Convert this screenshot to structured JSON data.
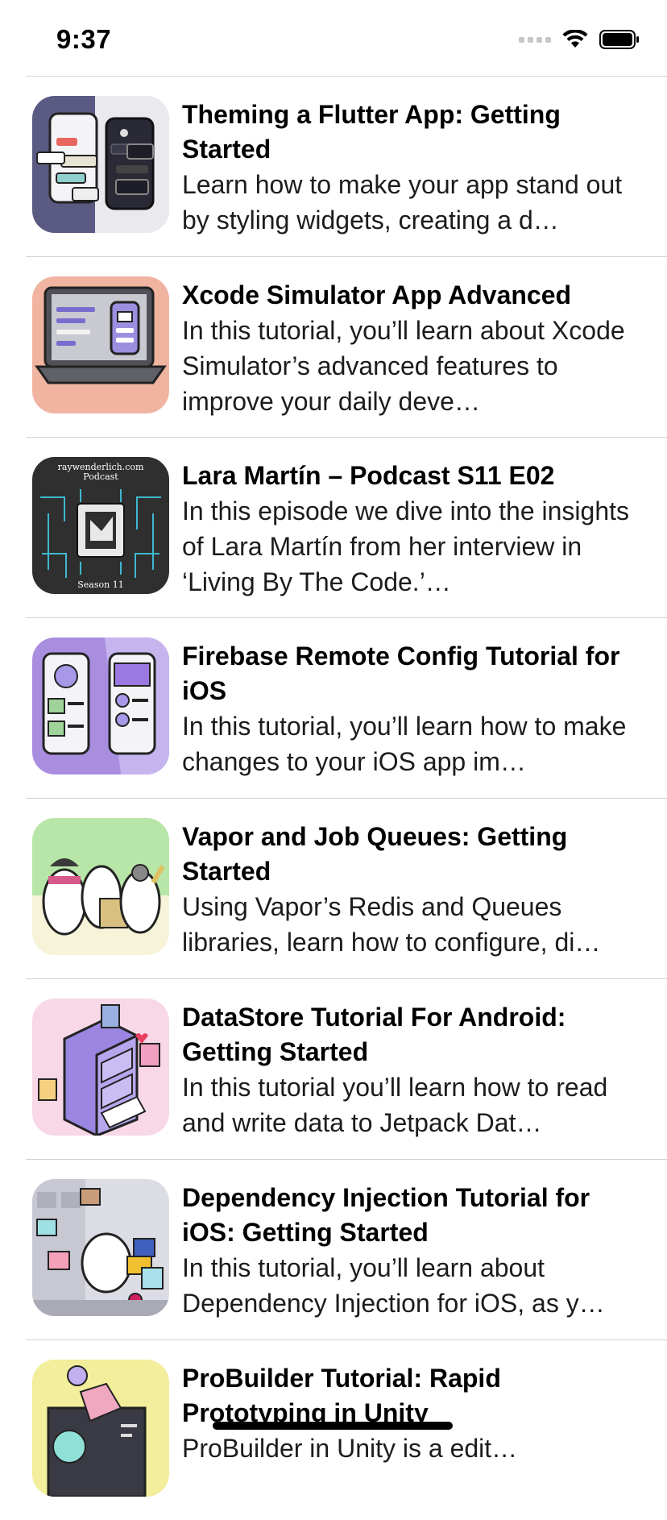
{
  "status": {
    "time": "9:37"
  },
  "articles": [
    {
      "title": "Theming a Flutter App: Getting Started",
      "description": "Learn how to make your app stand out by styling widgets, creating a d…"
    },
    {
      "title": "Xcode Simulator App Advanced",
      "description": "In this tutorial, you’ll learn about Xcode Simulator’s advanced features to improve your daily deve…"
    },
    {
      "title": "Lara Martín – Podcast S11 E02",
      "description": "In this episode we dive into the insights of Lara Martín from her interview in ‘Living By The Code.’…",
      "thumb_text_top": "raywenderlich.com",
      "thumb_text_mid": "Podcast",
      "thumb_text_bottom": "Season 11"
    },
    {
      "title": "Firebase Remote Config Tutorial for iOS",
      "description": "In this tutorial, you’ll learn how to make changes to your iOS app im…"
    },
    {
      "title": "Vapor and Job Queues: Getting Started",
      "description": "Using Vapor’s Redis and Queues libraries, learn how to configure, di…"
    },
    {
      "title": "DataStore Tutorial For Android: Getting Started",
      "description": "In this tutorial you’ll learn how to read and write data to Jetpack Dat…"
    },
    {
      "title": "Dependency Injection Tutorial for iOS: Getting Started",
      "description": "In this tutorial, you’ll learn about Dependency Injection for iOS, as y…"
    },
    {
      "title": "ProBuilder Tutorial: Rapid Prototyping in Unity",
      "description": "ProBuilder in Unity is a edit…"
    }
  ]
}
